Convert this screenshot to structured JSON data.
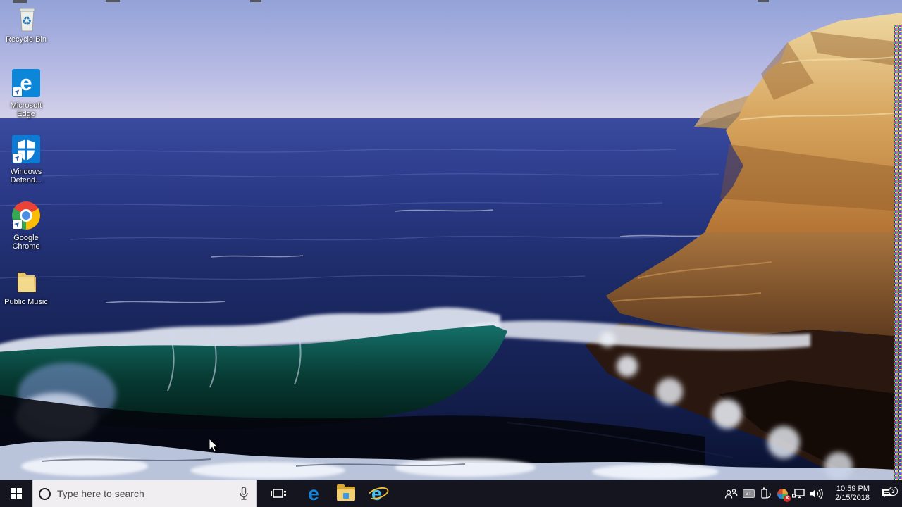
{
  "desktop": {
    "icons": [
      {
        "id": "recycle-bin",
        "label": "Recycle Bin"
      },
      {
        "id": "microsoft-edge",
        "label": "Microsoft Edge"
      },
      {
        "id": "windows-defender",
        "label": "Windows Defend..."
      },
      {
        "id": "google-chrome",
        "label": "Google Chrome"
      },
      {
        "id": "public-music",
        "label": "Public Music"
      }
    ]
  },
  "taskbar": {
    "search": {
      "placeholder": "Type here to search"
    },
    "tray": {
      "vm_badge": "VT",
      "clock": {
        "time": "10:59 PM",
        "date": "2/15/2018"
      },
      "action_center_badge": "3"
    }
  },
  "colors": {
    "taskbar_bg": "#15151f",
    "search_bg": "#f0eef1",
    "edge_blue": "#0c86d8",
    "defender_blue": "#0d7bd3",
    "folder_yellow": "#f3d070",
    "sky_top": "#93a2d8",
    "ocean_deep": "#0a1230",
    "cliff_orange": "#c98a45",
    "wave_teal": "#15706a"
  }
}
